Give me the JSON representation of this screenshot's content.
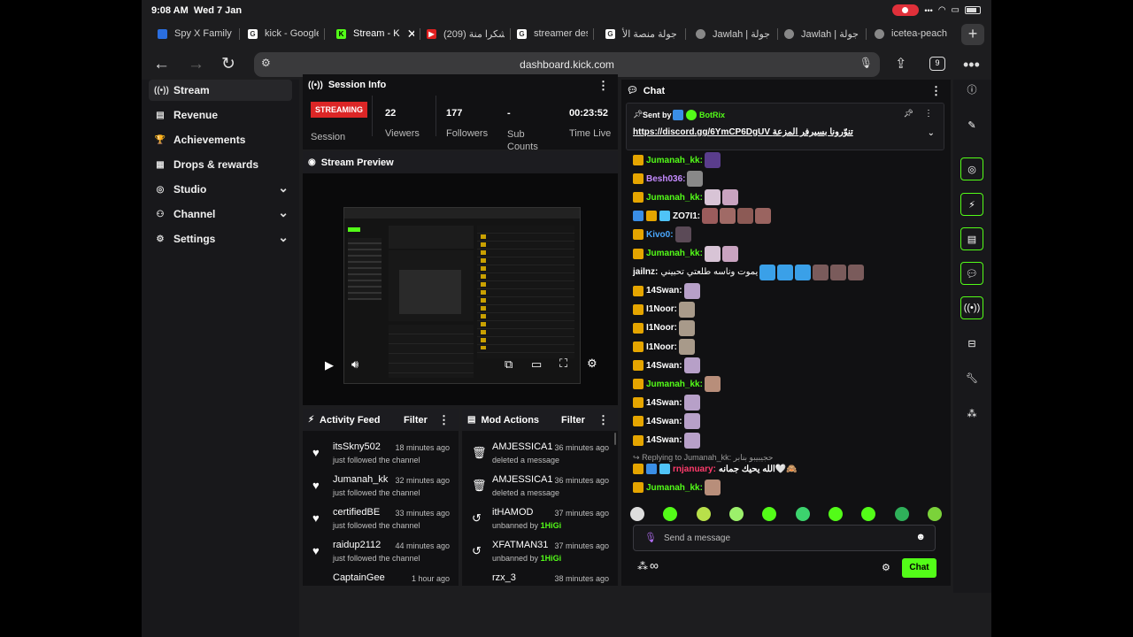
{
  "status": {
    "time": "9:08 AM",
    "date": "Wed 7 Jan"
  },
  "tabs": [
    {
      "label": "Spy X Family",
      "icon": "crunchyroll-icon",
      "color": "#2a6ee0"
    },
    {
      "label": "kick - Google",
      "icon": "google-icon",
      "color": "#ffffff"
    },
    {
      "label": "Stream - K",
      "icon": "kick-icon",
      "color": "#53fc18"
    },
    {
      "label": "(209) شكرا منة",
      "icon": "youtube-icon",
      "color": "#e02020"
    },
    {
      "label": "streamer des",
      "icon": "google-icon",
      "color": "#ffffff"
    },
    {
      "label": "جولة منصة الأ",
      "icon": "google-icon",
      "color": "#ffffff"
    },
    {
      "label": "Jawlah | جولة",
      "icon": "globe-icon",
      "color": "#888888"
    },
    {
      "label": "Jawlah | جولة",
      "icon": "globe-icon",
      "color": "#888888"
    },
    {
      "label": "icetea-peach",
      "icon": "site-icon",
      "color": "#888888"
    }
  ],
  "nav": {
    "url": "dashboard.kick.com",
    "tab_count": "9"
  },
  "sidebar": {
    "items": [
      {
        "label": "Stream",
        "icon": "broadcast-icon"
      },
      {
        "label": "Revenue",
        "icon": "revenue-icon"
      },
      {
        "label": "Achievements",
        "icon": "trophy-icon"
      },
      {
        "label": "Drops & rewards",
        "icon": "gift-icon"
      },
      {
        "label": "Studio",
        "icon": "studio-icon"
      },
      {
        "label": "Channel",
        "icon": "channel-icon"
      },
      {
        "label": "Settings",
        "icon": "gear-icon"
      }
    ]
  },
  "session": {
    "title": "Session Info",
    "live_badge": "STREAMING",
    "session_label": "Session",
    "stats": [
      {
        "value": "22",
        "label": "Viewers"
      },
      {
        "value": "177",
        "label": "Followers"
      },
      {
        "value": "-",
        "label": "Sub Counts"
      },
      {
        "value": "00:23:52",
        "label": "Time Live"
      }
    ]
  },
  "preview": {
    "title": "Stream Preview"
  },
  "activity": {
    "title": "Activity Feed",
    "filter": "Filter",
    "items": [
      {
        "name": "itsSkny502",
        "time": "18 minutes ago",
        "sub": "just followed the channel"
      },
      {
        "name": "Jumanah_kk",
        "time": "32 minutes ago",
        "sub": "just followed the channel"
      },
      {
        "name": "certifiedBE",
        "time": "33 minutes ago",
        "sub": "just followed the channel"
      },
      {
        "name": "raidup2112",
        "time": "44 minutes ago",
        "sub": "just followed the channel"
      },
      {
        "name": "CaptainGee",
        "time": "1 hour ago",
        "sub": ""
      }
    ]
  },
  "mod": {
    "title": "Mod Actions",
    "filter": "Filter",
    "items": [
      {
        "name": "AMJESSICA1",
        "time": "36 minutes ago",
        "sub": "deleted a message",
        "by": ""
      },
      {
        "name": "AMJESSICA1",
        "time": "36 minutes ago",
        "sub": "deleted a message",
        "by": ""
      },
      {
        "name": "itHAMOD",
        "time": "37 minutes ago",
        "sub": "unbanned by ",
        "by": "1HiGi"
      },
      {
        "name": "XFATMAN31",
        "time": "37 minutes ago",
        "sub": "unbanned by ",
        "by": "1HiGi"
      },
      {
        "name": "rzx_3",
        "time": "38 minutes ago",
        "sub": "",
        "by": ""
      }
    ]
  },
  "chat": {
    "title": "Chat",
    "pinned": {
      "sent_by": "Sent by",
      "author": "BotRix",
      "text": "https://discord.gg/6YmCP6DgUV تنوّرونا بسيرفر المزعة"
    },
    "messages": [
      {
        "user": "Jumanah_kk:",
        "color": "#53fc18",
        "emotes": [
          "#5a3d8c"
        ],
        "text": ""
      },
      {
        "user": "Besh036:",
        "color": "#c58bff",
        "emotes": [
          "#888888"
        ],
        "text": ""
      },
      {
        "user": "Jumanah_kk:",
        "color": "#53fc18",
        "emotes": [
          "#d8c4d6",
          "#c9a3c0"
        ],
        "text": ""
      },
      {
        "user": "ZO7I1:",
        "color": "#ffffff",
        "emotes": [
          "#9b5c5c",
          "#a06a66",
          "#8c5a55",
          "#9a6460"
        ],
        "text": ""
      },
      {
        "user": "Kivo0:",
        "color": "#4aa8ff",
        "emotes": [
          "#5b4a57"
        ],
        "text": ""
      },
      {
        "user": "Jumanah_kk:",
        "color": "#53fc18",
        "emotes": [
          "#d8c4d6",
          "#c9a3c0"
        ],
        "text": ""
      },
      {
        "user": "jailnz:",
        "color": "#ffffff",
        "emotes": [
          "#3aa0e8",
          "#3aa0e8",
          "#3aa0e8",
          "#7a5b5b",
          "#7a5b5b",
          "#7a5b5b"
        ],
        "text": "يموت وناسه طلعتي تحبيني"
      },
      {
        "user": "14Swan:",
        "color": "#ffffff",
        "emotes": [
          "#b7a0c8"
        ],
        "text": ""
      },
      {
        "user": "I1Noor:",
        "color": "#ffffff",
        "emotes": [
          "#a89a8a"
        ],
        "text": ""
      },
      {
        "user": "I1Noor:",
        "color": "#ffffff",
        "emotes": [
          "#a89a8a"
        ],
        "text": ""
      },
      {
        "user": "I1Noor:",
        "color": "#ffffff",
        "emotes": [
          "#a89a8a"
        ],
        "text": ""
      },
      {
        "user": "14Swan:",
        "color": "#ffffff",
        "emotes": [
          "#b7a0c8"
        ],
        "text": ""
      },
      {
        "user": "Jumanah_kk:",
        "color": "#53fc18",
        "emotes": [
          "#b88e7a"
        ],
        "text": ""
      },
      {
        "user": "14Swan:",
        "color": "#ffffff",
        "emotes": [
          "#b7a0c8"
        ],
        "text": ""
      },
      {
        "user": "14Swan:",
        "color": "#ffffff",
        "emotes": [
          "#b7a0c8"
        ],
        "text": ""
      },
      {
        "user": "14Swan:",
        "color": "#ffffff",
        "emotes": [
          "#b7a0c8"
        ],
        "text": ""
      }
    ],
    "reply_label": "Replying to Jumanah_kk: حجيبيبو بنابر",
    "reply_msg": {
      "user": "rnjanuary:",
      "color": "#ff3b6b",
      "text": "الله يحيك جمانه🤍🙈"
    },
    "last_msg": {
      "user": "Jumanah_kk:",
      "color": "#53fc18",
      "emotes": [
        "#b88e7a"
      ]
    },
    "input_placeholder": "Send a message",
    "send_label": "Chat",
    "infinity": "∞"
  },
  "colors": {
    "accent": "#53fc18",
    "live": "#dc2626",
    "bg": "#111113"
  }
}
